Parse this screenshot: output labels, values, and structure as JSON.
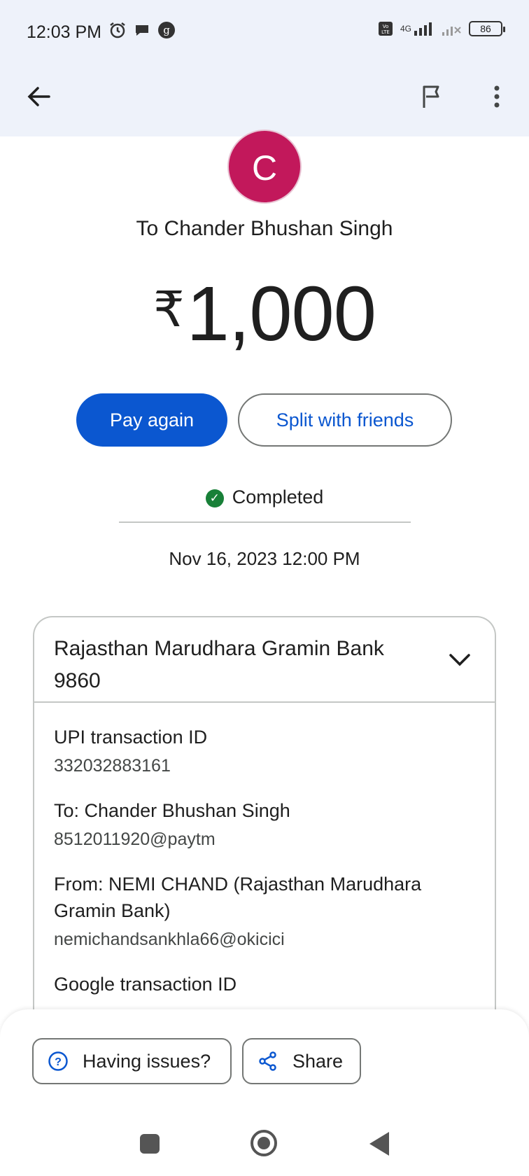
{
  "status_bar": {
    "time": "12:03 PM",
    "network": "4G",
    "battery": "86"
  },
  "app_bar": {
    "back_icon": "arrow-left-icon",
    "flag_icon": "flag-icon",
    "more_icon": "more-vert-icon"
  },
  "payee": {
    "avatar_letter": "C",
    "avatar_color": "#c2185b",
    "title": "To Chander Bhushan Singh"
  },
  "payment": {
    "currency_symbol": "₹",
    "amount": "1,000"
  },
  "actions": {
    "pay_again": "Pay again",
    "split": "Split with friends"
  },
  "status": {
    "label": "Completed",
    "color": "#188038"
  },
  "datetime": "Nov 16, 2023 12:00 PM",
  "details": {
    "bank_line1": "Rajasthan Marudhara Gramin Bank",
    "bank_line2": "9860",
    "rows": [
      {
        "label": "UPI transaction ID",
        "value": "332032883161"
      },
      {
        "label": "To: Chander Bhushan Singh",
        "value": "8512011920@paytm"
      },
      {
        "label": "From: NEMI CHAND (Rajasthan Marudhara Gramin Bank)",
        "value": "nemichandsankhla66@okicici"
      },
      {
        "label": "Google transaction ID",
        "value": ""
      }
    ]
  },
  "bottom": {
    "issues": "Having issues?",
    "share": "Share"
  },
  "colors": {
    "accent": "#0b57d0",
    "header_bg": "#eef2fa"
  }
}
